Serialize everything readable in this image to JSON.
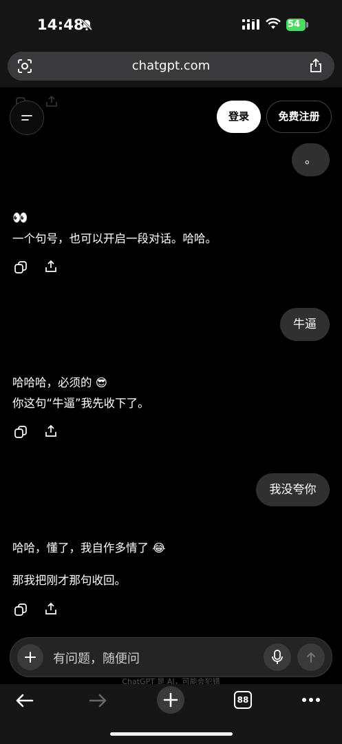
{
  "status_bar": {
    "time": "14:48",
    "battery": "54"
  },
  "browser": {
    "url": "chatgpt.com",
    "tabs_count": "88"
  },
  "header": {
    "login_label": "登录",
    "signup_label": "免费注册"
  },
  "conversation": {
    "user_messages": [
      "。",
      "牛逼",
      "我没夸你"
    ],
    "assistant": {
      "m1_line1": "👀",
      "m1_line2": "一个句号，也可以开启一段对话。哈哈。",
      "m2_line1": "哈哈哈，必须的 😎",
      "m2_line2": "你这句“牛逼”我先收下了。",
      "m3_line1": "哈哈，懂了，我自作多情了 😂",
      "m3_line2": "那我把刚才那句收回。"
    }
  },
  "composer": {
    "placeholder": "有问题，随便问",
    "disclaimer": "ChatGPT 是 AI，可能会犯错"
  }
}
